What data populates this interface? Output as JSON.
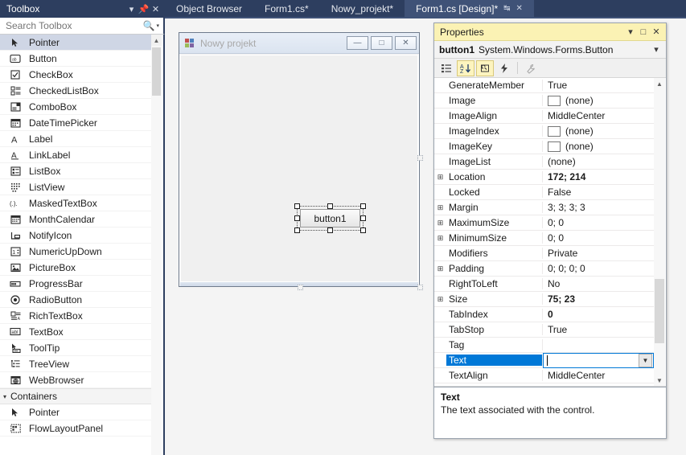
{
  "toolbox": {
    "title": "Toolbox",
    "search_placeholder": "Search Toolbox",
    "search_value": "",
    "header_icons": {
      "dropdown": "chevron-down-icon",
      "pin": "pin-icon",
      "close": "close-icon"
    },
    "items": [
      {
        "label": "Pointer",
        "icon": "pointer-icon",
        "selected": true
      },
      {
        "label": "Button",
        "icon": "button-icon",
        "selected": false
      },
      {
        "label": "CheckBox",
        "icon": "checkbox-icon",
        "selected": false
      },
      {
        "label": "CheckedListBox",
        "icon": "checkedlistbox-icon",
        "selected": false
      },
      {
        "label": "ComboBox",
        "icon": "combobox-icon",
        "selected": false
      },
      {
        "label": "DateTimePicker",
        "icon": "datetimepicker-icon",
        "selected": false
      },
      {
        "label": "Label",
        "icon": "label-icon",
        "selected": false
      },
      {
        "label": "LinkLabel",
        "icon": "linklabel-icon",
        "selected": false
      },
      {
        "label": "ListBox",
        "icon": "listbox-icon",
        "selected": false
      },
      {
        "label": "ListView",
        "icon": "listview-icon",
        "selected": false
      },
      {
        "label": "MaskedTextBox",
        "icon": "maskedtextbox-icon",
        "selected": false
      },
      {
        "label": "MonthCalendar",
        "icon": "monthcalendar-icon",
        "selected": false
      },
      {
        "label": "NotifyIcon",
        "icon": "notifyicon-icon",
        "selected": false
      },
      {
        "label": "NumericUpDown",
        "icon": "numericupdown-icon",
        "selected": false
      },
      {
        "label": "PictureBox",
        "icon": "picturebox-icon",
        "selected": false
      },
      {
        "label": "ProgressBar",
        "icon": "progressbar-icon",
        "selected": false
      },
      {
        "label": "RadioButton",
        "icon": "radiobutton-icon",
        "selected": false
      },
      {
        "label": "RichTextBox",
        "icon": "richtextbox-icon",
        "selected": false
      },
      {
        "label": "TextBox",
        "icon": "textbox-icon",
        "selected": false
      },
      {
        "label": "ToolTip",
        "icon": "tooltip-icon",
        "selected": false
      },
      {
        "label": "TreeView",
        "icon": "treeview-icon",
        "selected": false
      },
      {
        "label": "WebBrowser",
        "icon": "webbrowser-icon",
        "selected": false
      }
    ],
    "group": {
      "label": "Containers",
      "expanded": true
    },
    "group_items": [
      {
        "label": "Pointer",
        "icon": "pointer-icon"
      },
      {
        "label": "FlowLayoutPanel",
        "icon": "flowlayoutpanel-icon"
      }
    ]
  },
  "tabs": [
    {
      "label": "Object Browser",
      "active": false
    },
    {
      "label": "Form1.cs*",
      "active": false
    },
    {
      "label": "Nowy_projekt*",
      "active": false
    },
    {
      "label": "Form1.cs [Design]*",
      "active": true
    }
  ],
  "designer": {
    "form": {
      "title": "Nowy projekt",
      "minimize_label": "—",
      "maximize_label": "□",
      "close_label": "✕"
    },
    "control": {
      "label": "button1",
      "name": "button1"
    }
  },
  "properties": {
    "title": "Properties",
    "object_name": "button1",
    "object_type": "System.Windows.Forms.Button",
    "toolbar": [
      {
        "name": "categorized-view-button",
        "glyph": "▤",
        "active": false
      },
      {
        "name": "alphabetical-view-button",
        "glyph": "A↓",
        "active": true
      },
      {
        "name": "properties-button",
        "glyph": "⌗",
        "active": true
      },
      {
        "name": "events-button",
        "glyph": "⚡",
        "active": false
      },
      {
        "name": "property-pages-button",
        "glyph": "ὒ7",
        "active": false,
        "disabled": true
      }
    ],
    "rows": [
      {
        "name": "GenerateMember",
        "value": "True",
        "expandable": false,
        "bold": false,
        "swatch": false
      },
      {
        "name": "Image",
        "value": "(none)",
        "expandable": false,
        "bold": false,
        "swatch": true
      },
      {
        "name": "ImageAlign",
        "value": "MiddleCenter",
        "expandable": false,
        "bold": false,
        "swatch": false
      },
      {
        "name": "ImageIndex",
        "value": "(none)",
        "expandable": false,
        "bold": false,
        "swatch": true
      },
      {
        "name": "ImageKey",
        "value": "(none)",
        "expandable": false,
        "bold": false,
        "swatch": true
      },
      {
        "name": "ImageList",
        "value": "(none)",
        "expandable": false,
        "bold": false,
        "swatch": false
      },
      {
        "name": "Location",
        "value": "172; 214",
        "expandable": true,
        "bold": true,
        "swatch": false
      },
      {
        "name": "Locked",
        "value": "False",
        "expandable": false,
        "bold": false,
        "swatch": false
      },
      {
        "name": "Margin",
        "value": "3; 3; 3; 3",
        "expandable": true,
        "bold": false,
        "swatch": false
      },
      {
        "name": "MaximumSize",
        "value": "0; 0",
        "expandable": true,
        "bold": false,
        "swatch": false
      },
      {
        "name": "MinimumSize",
        "value": "0; 0",
        "expandable": true,
        "bold": false,
        "swatch": false
      },
      {
        "name": "Modifiers",
        "value": "Private",
        "expandable": false,
        "bold": false,
        "swatch": false
      },
      {
        "name": "Padding",
        "value": "0; 0; 0; 0",
        "expandable": true,
        "bold": false,
        "swatch": false
      },
      {
        "name": "RightToLeft",
        "value": "No",
        "expandable": false,
        "bold": false,
        "swatch": false
      },
      {
        "name": "Size",
        "value": "75; 23",
        "expandable": true,
        "bold": true,
        "swatch": false
      },
      {
        "name": "TabIndex",
        "value": "0",
        "expandable": false,
        "bold": true,
        "swatch": false
      },
      {
        "name": "TabStop",
        "value": "True",
        "expandable": false,
        "bold": false,
        "swatch": false
      },
      {
        "name": "Tag",
        "value": "",
        "expandable": false,
        "bold": false,
        "swatch": false
      }
    ],
    "active_row": {
      "name": "Text",
      "value": "",
      "editing": true
    },
    "rows_after": [
      {
        "name": "TextAlign",
        "value": "MiddleCenter",
        "expandable": false,
        "bold": false,
        "swatch": false
      }
    ],
    "description": {
      "title": "Text",
      "body": "The text associated with the control."
    }
  },
  "colors": {
    "chrome": "#2d3e5f",
    "tab_active": "#3f5277",
    "properties_title": "#fbf2b4",
    "selection_blue": "#0078d7",
    "toolbox_selected": "#cfd6e5"
  }
}
